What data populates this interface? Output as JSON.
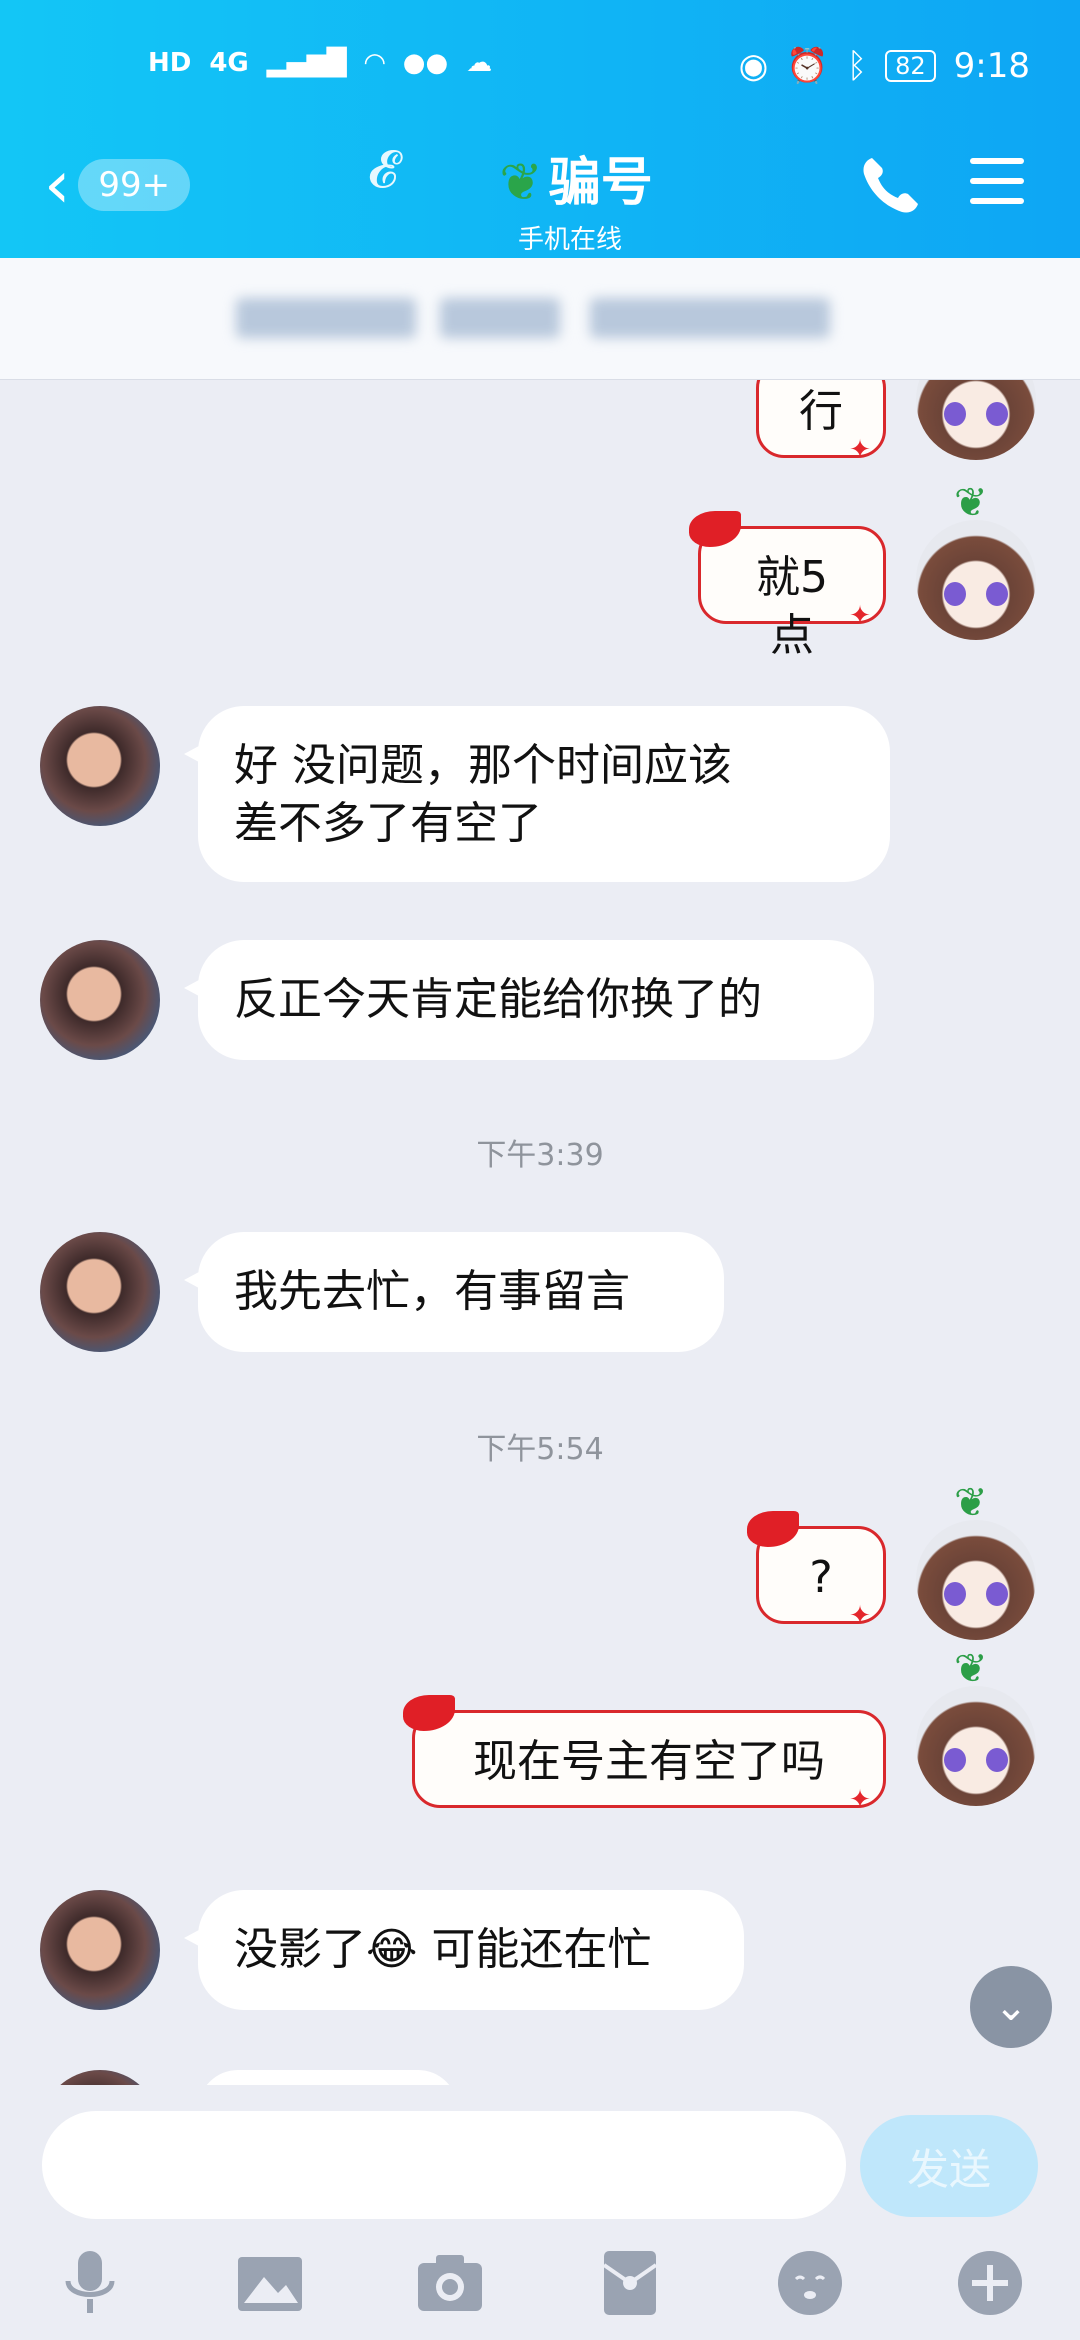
{
  "status_bar": {
    "left_icons": [
      "HD",
      "4G",
      "signal-icon",
      "wifi-icon",
      "wechat-icon",
      "cloud-icon",
      "app-icon"
    ],
    "battery": "82",
    "time": "9:18"
  },
  "header": {
    "back_badge": "99+",
    "title": "骗号",
    "subtitle": "手机在线"
  },
  "messages": [
    {
      "side": "self",
      "text": "行"
    },
    {
      "side": "self",
      "text": "就5点"
    },
    {
      "side": "peer",
      "lines": [
        "好 没问题，那个时间应该",
        "差不多了有空了"
      ]
    },
    {
      "side": "peer",
      "text": "反正今天肯定能给你换了的"
    },
    {
      "time": "下午3:39"
    },
    {
      "side": "peer",
      "text": "我先去忙，有事留言"
    },
    {
      "time": "下午5:54"
    },
    {
      "side": "self",
      "text": "?"
    },
    {
      "side": "self",
      "text": "现在号主有空了吗"
    },
    {
      "side": "peer",
      "text": "没影了😂 可能还在忙"
    }
  ],
  "input": {
    "placeholder": "",
    "send_label": "发送"
  },
  "colors": {
    "header_start": "#13c6f6",
    "header_end": "#0ea6f4",
    "self_bubble_border": "#d9282c",
    "send_button": "#bfe7fb"
  },
  "toolbar_icons": [
    "microphone-icon",
    "image-icon",
    "camera-icon",
    "red-packet-icon",
    "emoji-icon",
    "plus-icon"
  ]
}
